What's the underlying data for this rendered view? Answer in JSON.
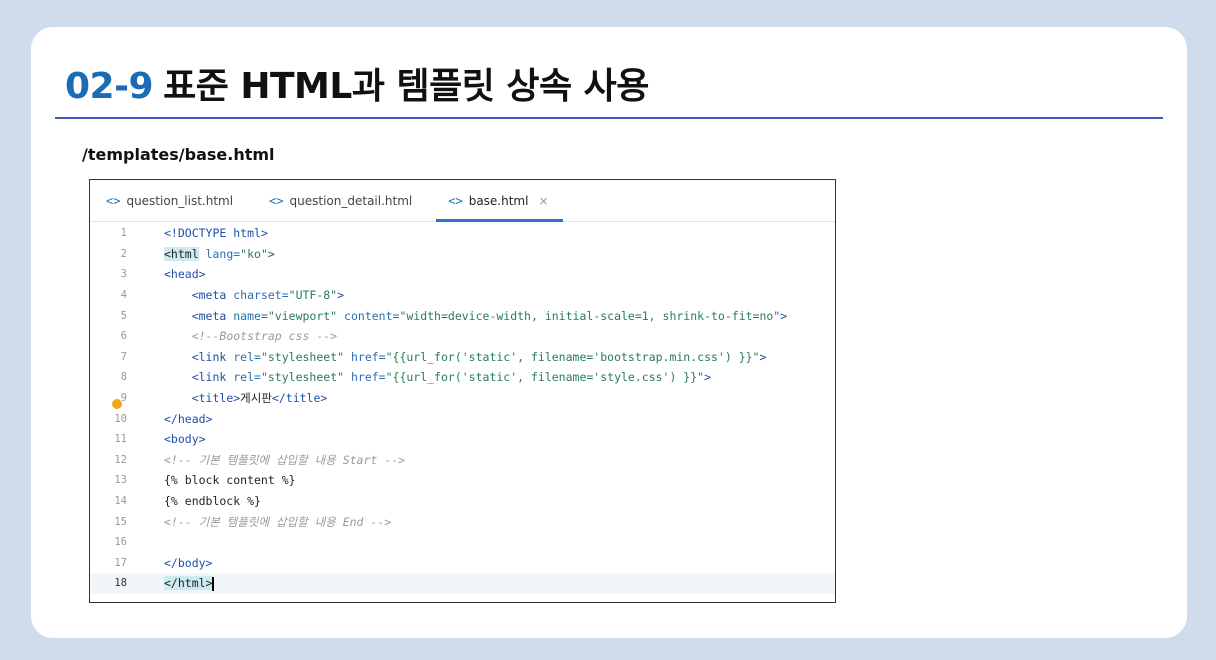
{
  "slide": {
    "title_number": "02-9",
    "title_text": "표준 HTML과 템플릿 상속 사용",
    "file_path": "/templates/base.html"
  },
  "editor": {
    "tabs": [
      {
        "label": "question_list.html",
        "icon": "code-brackets-icon",
        "active": false
      },
      {
        "label": "question_detail.html",
        "icon": "code-brackets-icon",
        "active": false
      },
      {
        "label": "base.html",
        "icon": "code-brackets-icon",
        "active": true,
        "closable": true
      }
    ],
    "tab_icon_glyph": "<>",
    "close_glyph": "×",
    "current_line": 18,
    "lines": [
      {
        "n": "1",
        "indent": "",
        "tokens": [
          [
            "tag",
            "<!DOCTYPE "
          ],
          [
            "kw",
            "html"
          ],
          [
            "tag",
            ">"
          ]
        ]
      },
      {
        "n": "2",
        "indent": "",
        "tokens": [
          [
            "hl",
            "<html"
          ],
          [
            "attr",
            " lang="
          ],
          [
            "str",
            "\"ko\""
          ],
          [
            "tag",
            ">"
          ]
        ]
      },
      {
        "n": "3",
        "indent": "",
        "tokens": [
          [
            "tag",
            "<head>"
          ]
        ]
      },
      {
        "n": "4",
        "indent": "    ",
        "tokens": [
          [
            "tag",
            "<meta"
          ],
          [
            "attr",
            " charset="
          ],
          [
            "str",
            "\"UTF-8\""
          ],
          [
            "tag",
            ">"
          ]
        ]
      },
      {
        "n": "5",
        "indent": "    ",
        "tokens": [
          [
            "tag",
            "<meta"
          ],
          [
            "attr",
            " name="
          ],
          [
            "str",
            "\"viewport\""
          ],
          [
            "attr",
            " content="
          ],
          [
            "str",
            "\"width=device-width, initial-scale=1, shrink-to-fit=no\""
          ],
          [
            "tag",
            ">"
          ]
        ]
      },
      {
        "n": "6",
        "indent": "    ",
        "tokens": [
          [
            "cmt",
            "<!--Bootstrap css -->"
          ]
        ]
      },
      {
        "n": "7",
        "indent": "    ",
        "tokens": [
          [
            "tag",
            "<link"
          ],
          [
            "attr",
            " rel="
          ],
          [
            "str",
            "\"stylesheet\""
          ],
          [
            "attr",
            " href="
          ],
          [
            "str",
            "\"{{url_for('static', filename='bootstrap.min.css') }}\""
          ],
          [
            "tag",
            ">"
          ]
        ]
      },
      {
        "n": "8",
        "indent": "    ",
        "tokens": [
          [
            "tag",
            "<link"
          ],
          [
            "attr",
            " rel="
          ],
          [
            "str",
            "\"stylesheet\""
          ],
          [
            "attr",
            " href="
          ],
          [
            "str",
            "\"{{url_for('static', filename='style.css') }}\""
          ],
          [
            "tag",
            ">"
          ]
        ]
      },
      {
        "n": "9",
        "indent": "    ",
        "tokens": [
          [
            "tag",
            "<title>"
          ],
          [
            "txt",
            "게시판"
          ],
          [
            "tag",
            "</title>"
          ]
        ]
      },
      {
        "n": "10",
        "indent": "",
        "tokens": [
          [
            "tag",
            "</head>"
          ]
        ]
      },
      {
        "n": "11",
        "indent": "",
        "tokens": [
          [
            "tag",
            "<body>"
          ]
        ]
      },
      {
        "n": "12",
        "indent": "",
        "tokens": [
          [
            "cmt",
            "<!-- 기본 템플릿에 삽입할 내용 Start -->"
          ]
        ]
      },
      {
        "n": "13",
        "indent": "",
        "tokens": [
          [
            "txt",
            "{% block content %}"
          ]
        ]
      },
      {
        "n": "14",
        "indent": "",
        "tokens": [
          [
            "txt",
            "{% endblock %}"
          ]
        ]
      },
      {
        "n": "15",
        "indent": "",
        "tokens": [
          [
            "cmt",
            "<!-- 기본 템플릿에 삽입할 내용 End -->"
          ]
        ]
      },
      {
        "n": "16",
        "indent": "",
        "tokens": []
      },
      {
        "n": "17",
        "indent": "",
        "tokens": [
          [
            "tag",
            "</body>"
          ]
        ]
      },
      {
        "n": "18",
        "indent": "",
        "tokens": [
          [
            "hl",
            "</html>"
          ],
          [
            "caret",
            ""
          ]
        ]
      }
    ]
  },
  "colors": {
    "accent_number": "#1a6db5",
    "rule": "#3f5bb8",
    "active_tab_underline": "#2f6fd0",
    "cursor_dot": "#f2a51a"
  }
}
